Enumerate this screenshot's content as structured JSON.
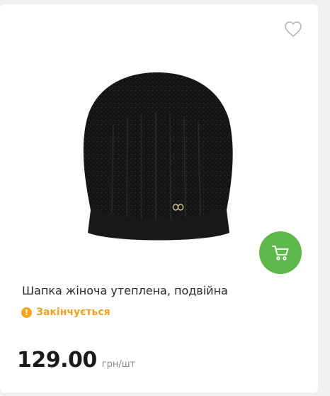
{
  "product": {
    "title": "Шапка жіноча утеплена, подвійна",
    "status": "Закінчується",
    "price": "129.00",
    "unit": "грн/шт"
  },
  "icons": {
    "favorite": "heart-outline-icon",
    "cart": "shopping-cart-icon",
    "status": "exclamation-circle-icon"
  },
  "colors": {
    "cart_button": "#5cb94a",
    "status": "#f2a21f",
    "background": "#f0f0f1"
  }
}
